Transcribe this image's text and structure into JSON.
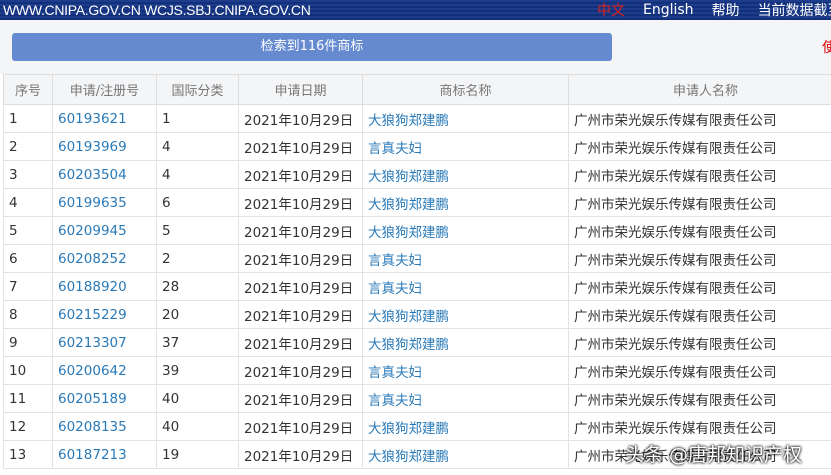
{
  "header": {
    "site": "WWW.CNIPA.GOV.CN WCJS.SBJ.CNIPA.GOV.CN",
    "lang_zh": "中文",
    "lang_en": "English",
    "help": "帮助",
    "data_cutoff": "当前数据截至"
  },
  "summary": "检索到116件商标",
  "right_mark": "使",
  "columns": [
    "序号",
    "申请/注册号",
    "国际分类",
    "申请日期",
    "商标名称",
    "申请人名称"
  ],
  "rows": [
    [
      "1",
      "60193621",
      "1",
      "2021年10月29日",
      "大狼狗郑建鹏",
      "广州市荣光娱乐传媒有限责任公司"
    ],
    [
      "2",
      "60193969",
      "4",
      "2021年10月29日",
      "言真夫妇",
      "广州市荣光娱乐传媒有限责任公司"
    ],
    [
      "3",
      "60203504",
      "4",
      "2021年10月29日",
      "大狼狗郑建鹏",
      "广州市荣光娱乐传媒有限责任公司"
    ],
    [
      "4",
      "60199635",
      "6",
      "2021年10月29日",
      "大狼狗郑建鹏",
      "广州市荣光娱乐传媒有限责任公司"
    ],
    [
      "5",
      "60209945",
      "5",
      "2021年10月29日",
      "大狼狗郑建鹏",
      "广州市荣光娱乐传媒有限责任公司"
    ],
    [
      "6",
      "60208252",
      "2",
      "2021年10月29日",
      "言真夫妇",
      "广州市荣光娱乐传媒有限责任公司"
    ],
    [
      "7",
      "60188920",
      "28",
      "2021年10月29日",
      "言真夫妇",
      "广州市荣光娱乐传媒有限责任公司"
    ],
    [
      "8",
      "60215229",
      "20",
      "2021年10月29日",
      "大狼狗郑建鹏",
      "广州市荣光娱乐传媒有限责任公司"
    ],
    [
      "9",
      "60213307",
      "37",
      "2021年10月29日",
      "大狼狗郑建鹏",
      "广州市荣光娱乐传媒有限责任公司"
    ],
    [
      "10",
      "60200642",
      "39",
      "2021年10月29日",
      "言真夫妇",
      "广州市荣光娱乐传媒有限责任公司"
    ],
    [
      "11",
      "60205189",
      "40",
      "2021年10月29日",
      "言真夫妇",
      "广州市荣光娱乐传媒有限责任公司"
    ],
    [
      "12",
      "60208135",
      "40",
      "2021年10月29日",
      "大狼狗郑建鹏",
      "广州市荣光娱乐传媒有限责任公司"
    ],
    [
      "13",
      "60187213",
      "19",
      "2021年10月29日",
      "大狼狗郑建鹏",
      "广州市荣光娱乐传媒有限责任公司"
    ]
  ],
  "watermark": "头条 @唐邦知识产权"
}
